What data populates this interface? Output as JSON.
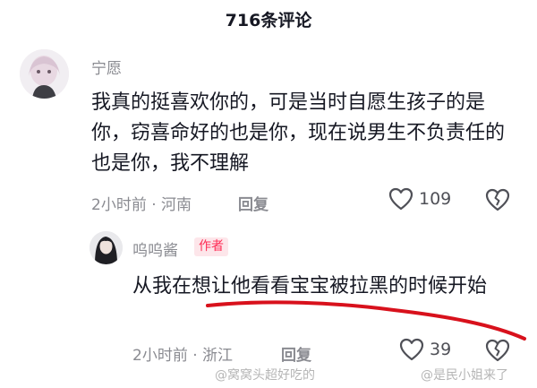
{
  "header": {
    "title": "716条评论"
  },
  "comment": {
    "username": "宁愿",
    "text": "我真的挺喜欢你的，可是当时自愿生孩子的是你，窃喜命好的也是你，现在说男生不负责任的也是你，我不理解",
    "meta": "2小时前 · 河南",
    "reply_label": "回复",
    "likes": "109"
  },
  "reply": {
    "username": "呜呜酱",
    "badge": "作者",
    "text": "从我在想让他看看宝宝被拉黑的时候开始",
    "meta": "2小时前 · 浙江",
    "reply_label": "回复",
    "likes": "39"
  },
  "watermarks": [
    "@窝窝头超好吃的",
    "@是民小姐来了"
  ],
  "colors": {
    "accent": "#fe2c55",
    "annotation": "#d8111c",
    "meta": "#8a8b91"
  }
}
